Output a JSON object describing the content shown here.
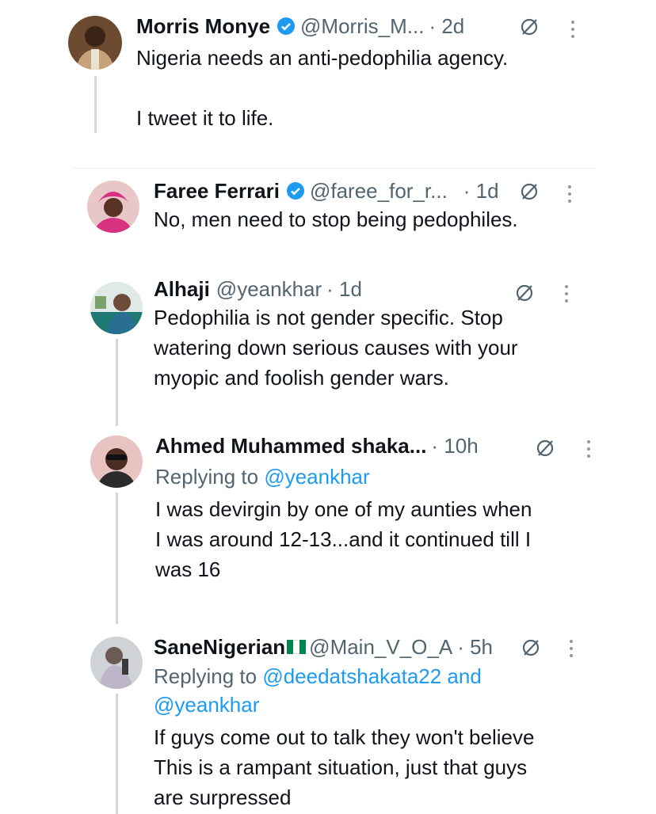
{
  "tweets": [
    {
      "name": "Morris Monye",
      "handle": "@Morris_M...",
      "time": "· 2d",
      "body": "Nigeria needs an anti-pedophilia agency.\n\nI tweet it to life."
    },
    {
      "name": "Faree Ferrari",
      "handle": "@faree_for_r...",
      "time": "· 1d",
      "body": "No, men need to stop being pedophiles."
    },
    {
      "name": "Alhaji",
      "handle": "@yeankhar",
      "time": "· 1d",
      "body": "Pedophilia is not gender specific. Stop\nwatering down serious causes with your\nmyopic and foolish gender wars."
    },
    {
      "name": "Ahmed Muhammed shaka...",
      "handle": "",
      "time": "· 10h",
      "reply_prefix": "Replying to",
      "reply_handles": "@yeankhar",
      "body": "I was devirgin by one of my aunties when\nI was around 12-13...and it continued till I\nwas  16"
    },
    {
      "name": "SaneNigerian",
      "handle": "@Main_V_O_A",
      "time": "· 5h",
      "reply_prefix": "Replying to",
      "reply_handles": "@deedatshakata22 and",
      "reply_handles_2": "@yeankhar",
      "body": "If guys come out to talk they won't believe\nThis is a rampant situation, just that guys\nare surpressed"
    }
  ],
  "colors": {
    "link": "#1d9bf0",
    "secondary": "#536471",
    "verified": "#1d9bf0",
    "line": "#cfd9de"
  },
  "icons": [
    "verified-badge-icon",
    "grok-icon",
    "more-icon",
    "nigeria-flag-icon"
  ]
}
